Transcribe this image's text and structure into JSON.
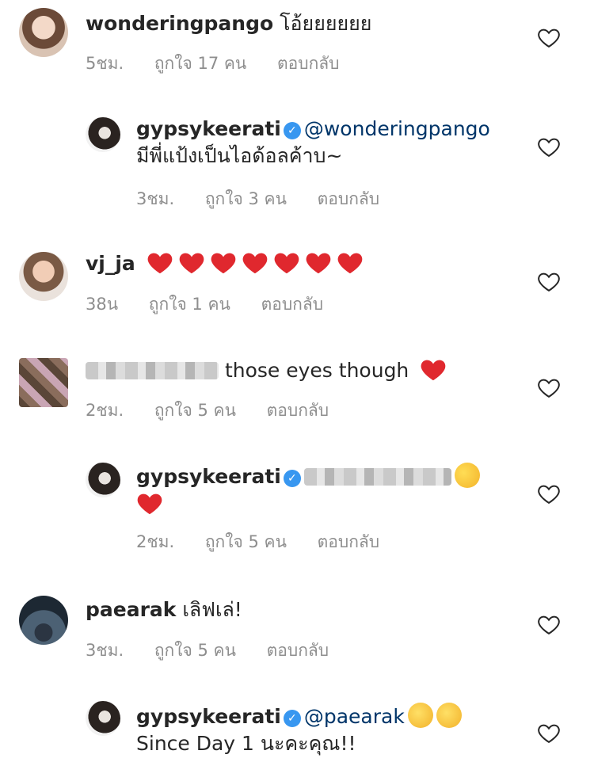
{
  "comments": [
    {
      "username": "wonderingpango",
      "text": "โอ้ยยยยยย",
      "time": "5ชม.",
      "likes": "ถูกใจ 17 คน",
      "reply": "ตอบกลับ"
    },
    {
      "username": "gypsykeerati",
      "mention": "@wonderingpango",
      "text": "มีพี่แป้งเป็นไอด้อลค้าบ~",
      "time": "3ชม.",
      "likes": "ถูกใจ 3 คน",
      "reply": "ตอบกลับ"
    },
    {
      "username": "vj_ja",
      "time": "38น",
      "likes": "ถูกใจ 1 คน",
      "reply": "ตอบกลับ",
      "heart_count": 7
    },
    {
      "text": "those eyes though",
      "time": "2ชม.",
      "likes": "ถูกใจ 5 คน",
      "reply": "ตอบกลับ"
    },
    {
      "username": "gypsykeerati",
      "time": "2ชม.",
      "likes": "ถูกใจ 5 คน",
      "reply": "ตอบกลับ"
    },
    {
      "username": "paearak",
      "text": "เลิฟเล่!",
      "time": "3ชม.",
      "likes": "ถูกใจ 5 คน",
      "reply": "ตอบกลับ"
    },
    {
      "username": "gypsykeerati",
      "mention": "@paearak",
      "text": "Since Day 1 นะคะคุณ!!"
    }
  ],
  "colors": {
    "accent": "#3897f0",
    "muted": "#8e8e8e",
    "heart_red": "#e0282e"
  }
}
